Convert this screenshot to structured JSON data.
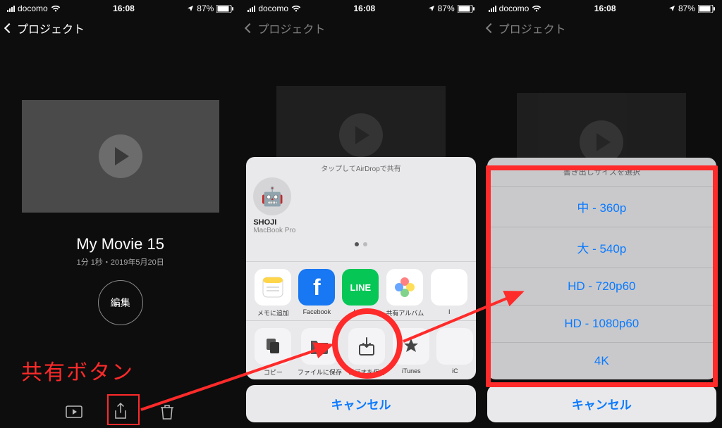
{
  "status": {
    "carrier": "docomo",
    "time": "16:08",
    "battery_pct": "87%"
  },
  "nav": {
    "back_label": "プロジェクト"
  },
  "screen1": {
    "movie_title": "My Movie 15",
    "movie_subtitle": "1分 1秒・2019年5月20日",
    "edit_label": "編集",
    "share_annotation": "共有ボタン"
  },
  "share_sheet": {
    "airdrop_hint": "タップしてAirDropで共有",
    "airdrop_contact": {
      "name": "SHOJI",
      "device": "MacBook Pro"
    },
    "apps": [
      {
        "label": "メモに追加",
        "bg": "#ffffff",
        "glyph": "memo"
      },
      {
        "label": "Facebook",
        "bg": "#1877f2",
        "glyph": "f"
      },
      {
        "label": "LINE",
        "bg": "#06c755",
        "glyph": "LINE"
      },
      {
        "label": "共有アルバム",
        "bg": "#ffffff",
        "glyph": "photos"
      },
      {
        "label": "I",
        "bg": "#ffffff",
        "glyph": ""
      }
    ],
    "actions": [
      {
        "label": "コピー",
        "glyph": "copy"
      },
      {
        "label": "ファイルに保存",
        "glyph": "folder"
      },
      {
        "label": "ビデオを保存",
        "glyph": "save-video"
      },
      {
        "label": "iTunes",
        "glyph": "star"
      },
      {
        "label": "iC",
        "glyph": ""
      }
    ],
    "cancel": "キャンセル"
  },
  "export": {
    "header": "書き出しサイズを選択",
    "options": [
      "中 - 360p",
      "大 - 540p",
      "HD - 720p60",
      "HD - 1080p60",
      "4K"
    ],
    "cancel": "キャンセル"
  }
}
